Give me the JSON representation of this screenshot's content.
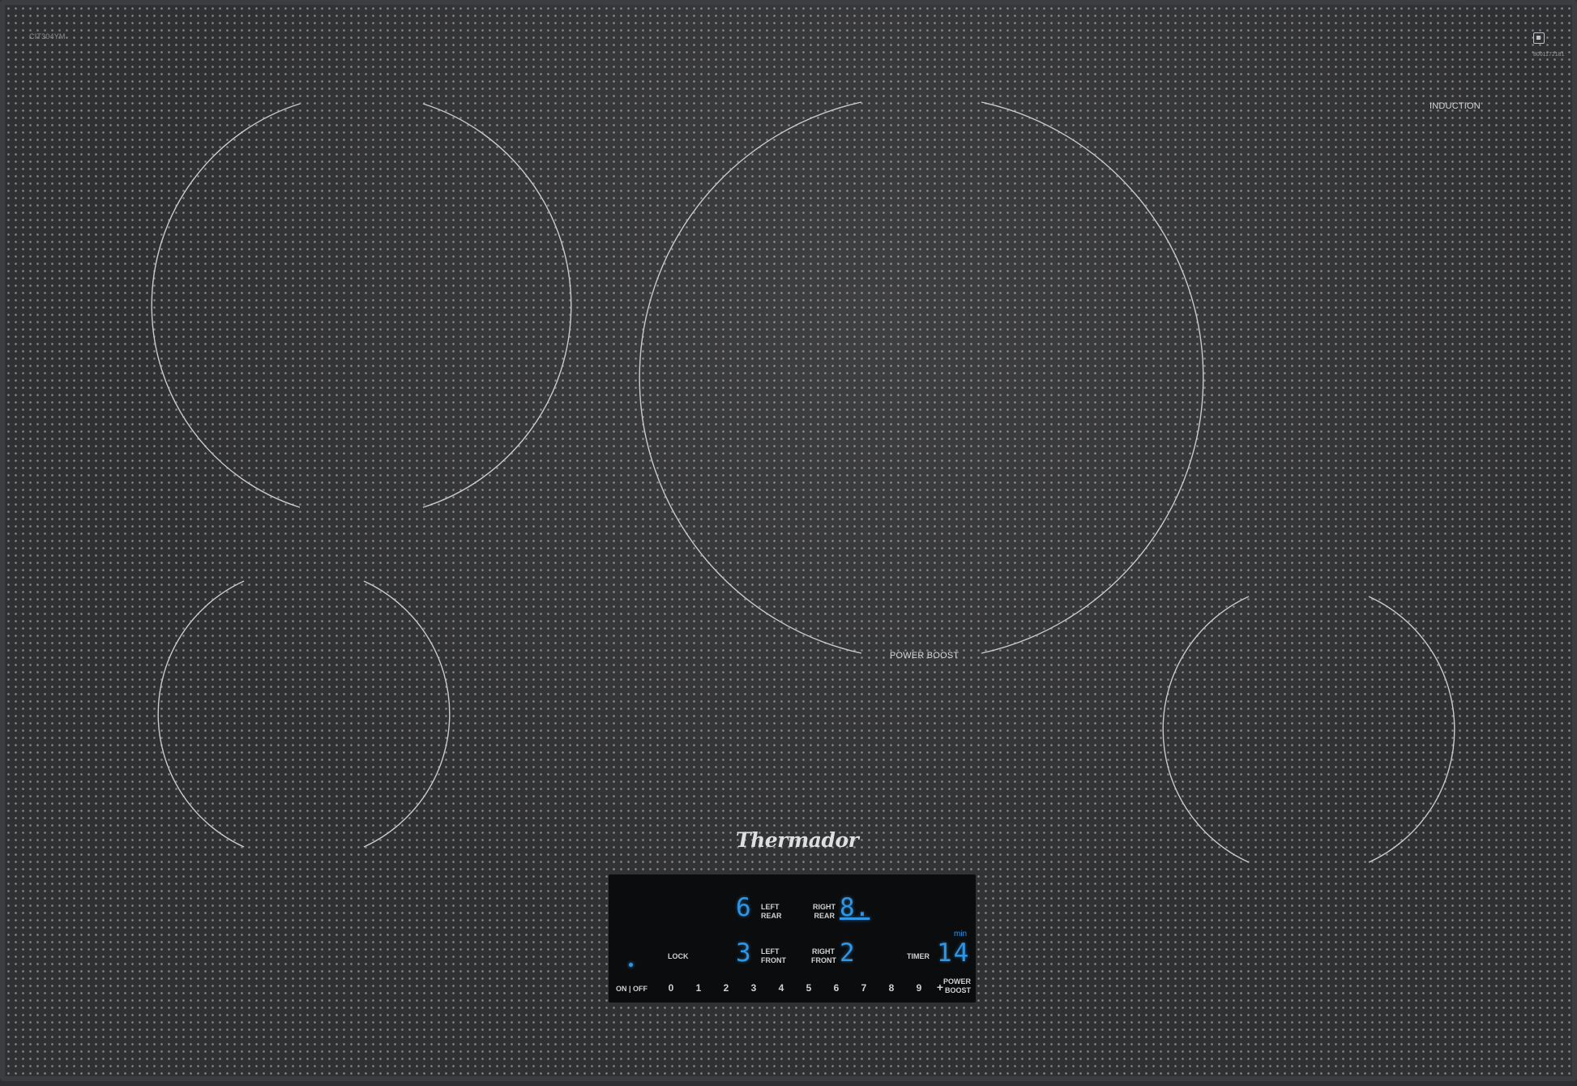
{
  "model": "CIT304YM",
  "serial": "8001172181",
  "induction_label": "INDUCTION",
  "power_boost_label": "POWER BOOST",
  "brand": "Thermador",
  "controls": {
    "left_rear": {
      "label_line1": "LEFT",
      "label_line2": "REAR",
      "value": "6"
    },
    "right_rear": {
      "label_line1": "RIGHT",
      "label_line2": "REAR",
      "value": "8."
    },
    "left_front": {
      "label_line1": "LEFT",
      "label_line2": "FRONT",
      "value": "3"
    },
    "right_front": {
      "label_line1": "RIGHT",
      "label_line2": "FRONT",
      "value": "2"
    },
    "lock_label": "LOCK",
    "timer_label": "TIMER",
    "timer_value": "14",
    "timer_unit": "min",
    "on_off_label": "ON | OFF",
    "power_boost_line1": "POWER",
    "power_boost_line2": "BOOST",
    "slider": [
      "0",
      "1",
      "2",
      "3",
      "4",
      "5",
      "6",
      "7",
      "8",
      "9",
      "+"
    ]
  },
  "colors": {
    "display": "#2f96e6",
    "glass": "#303133"
  }
}
